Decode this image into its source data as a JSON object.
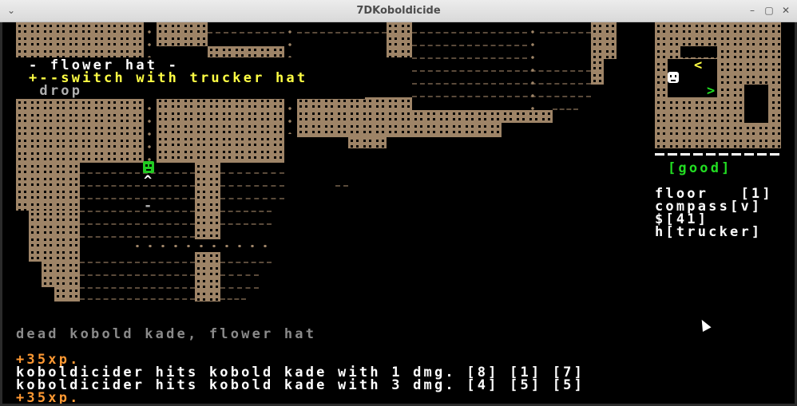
{
  "window": {
    "title": "7DKoboldicide",
    "menu_icon": "chevron-down-icon",
    "minimize_icon": "minimize-icon",
    "maximize_icon": "maximize-icon",
    "close_icon": "close-icon"
  },
  "item_menu": {
    "header": "- flower hat -",
    "options": [
      {
        "label": "+--switch with trucker hat",
        "selected": true
      },
      {
        "label": " drop",
        "selected": false
      }
    ]
  },
  "map": {
    "player_glyph": "player-smiley",
    "stairs_glyph": "^",
    "item_glyph": "-"
  },
  "minimap": {
    "marker_left": "<",
    "marker_right": ">",
    "divider": "- - - - - - - - - -",
    "status": "[good]"
  },
  "stats": {
    "floor": "floor   [1]",
    "compass": "compass[v]",
    "money": "$[41]",
    "hat": "h[trucker]"
  },
  "ground_text": "dead kobold kade, flower hat",
  "log": [
    {
      "text": "+35xp.",
      "kind": "xp"
    },
    {
      "text": "koboldicider hits kobold kade with 1 dmg. [8] [1] [7]",
      "kind": "hit"
    },
    {
      "text": "koboldicider hits kobold kade with 3 dmg. [4] [5] [5]",
      "kind": "hit"
    },
    {
      "text": "+35xp.",
      "kind": "xp"
    }
  ],
  "colors": {
    "wall": "#9e8467",
    "menu_text": "#ffff44",
    "xp_text": "#ff9933",
    "status_good": "#22dd22",
    "background": "#000000"
  }
}
